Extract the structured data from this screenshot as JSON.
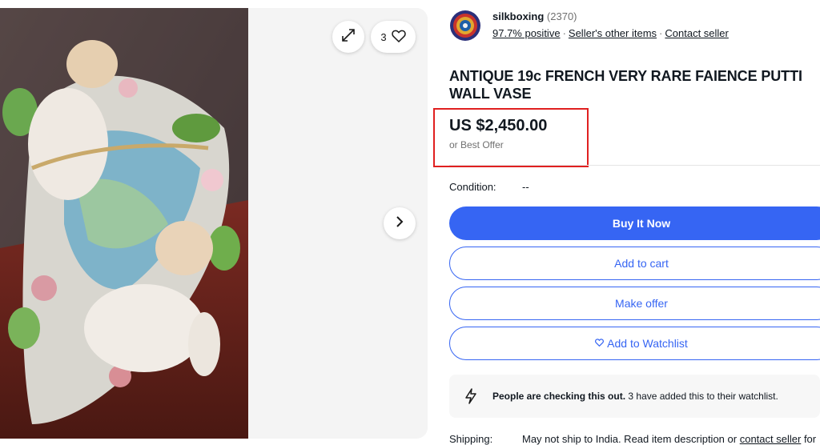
{
  "gallery": {
    "watch_count": "3",
    "icons": {
      "expand": "expand-icon",
      "watch": "heart-icon",
      "next": "chevron-right-icon"
    }
  },
  "seller": {
    "name": "silkboxing",
    "feedback_count": "(2370)",
    "positive": "97.7% positive",
    "other_items": "Seller's other items",
    "contact": "Contact seller"
  },
  "item": {
    "title": "ANTIQUE 19c FRENCH VERY RARE FAIENCE PUTTI WALL VASE",
    "price": "US $2,450.00",
    "offer_note": "or Best Offer",
    "condition_label": "Condition:",
    "condition_value": "--"
  },
  "actions": {
    "buy_now": "Buy It Now",
    "add_to_cart": "Add to cart",
    "make_offer": "Make offer",
    "add_to_watchlist": "Add to Watchlist"
  },
  "signal": {
    "headline": "People are checking this out.",
    "detail": "3 have added this to their watchlist.",
    "icon": "lightning-icon"
  },
  "shipping": {
    "label": "Shipping:",
    "value": "May not ship to India. Read item description or",
    "link": "contact seller",
    "tail": "for"
  },
  "colors": {
    "accent": "#3665f3",
    "highlight_box": "#e02020"
  }
}
